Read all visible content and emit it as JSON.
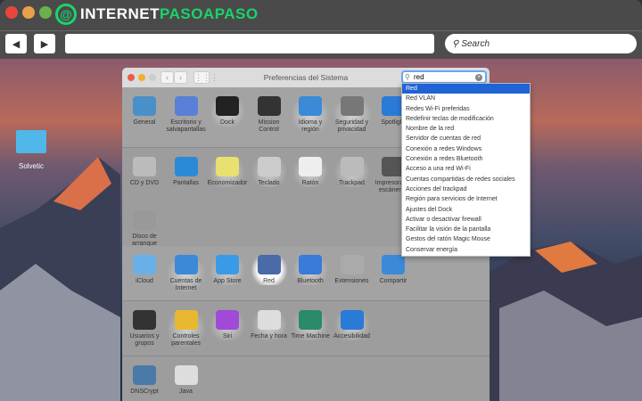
{
  "browser": {
    "logo_text_white": "INTERNET",
    "logo_text_green": "PASOAPASO",
    "back_icon": "◀",
    "forward_icon": "▶",
    "search_placeholder": "Search",
    "url_value": ""
  },
  "desktop": {
    "folder_label": "Solvetic"
  },
  "window": {
    "title": "Preferencias del Sistema",
    "nav_back": "‹",
    "nav_fwd": "›",
    "grid": "⋮⋮⋮",
    "sections": [
      [
        {
          "label": "General",
          "color": "#4a90c8"
        },
        {
          "label": "Escritorio y salvapantallas",
          "color": "#5a7fd6"
        },
        {
          "label": "Dock",
          "color": "#222"
        },
        {
          "label": "Mission Control",
          "color": "#333"
        },
        {
          "label": "Idioma y región",
          "color": "#3a8ad8"
        },
        {
          "label": "Seguridad y privacidad",
          "color": "#777"
        },
        {
          "label": "Spotlight",
          "color": "#2a7ad8"
        }
      ],
      [
        {
          "label": "CD y DVD",
          "color": "#bbb"
        },
        {
          "label": "Pantallas",
          "color": "#2a8ad8"
        },
        {
          "label": "Economizador",
          "color": "#e8e070"
        },
        {
          "label": "Teclado",
          "color": "#ccc"
        },
        {
          "label": "Ratón",
          "color": "#eee"
        },
        {
          "label": "Trackpad",
          "color": "#bbb"
        },
        {
          "label": "Impresoras y escáneres",
          "color": "#555"
        },
        {
          "label": "Disco de arranque",
          "color": "#999"
        }
      ],
      [
        {
          "label": "iCloud",
          "color": "#6ab0e8"
        },
        {
          "label": "Cuentas de Internet",
          "color": "#3a8ad8"
        },
        {
          "label": "App Store",
          "color": "#3a9ae8"
        },
        {
          "label": "Red",
          "color": "#4a6aa8"
        },
        {
          "label": "Bluetooth",
          "color": "#3a7ad8"
        },
        {
          "label": "Extensiones",
          "color": "#aaa"
        },
        {
          "label": "Compartir",
          "color": "#3a8ad8"
        }
      ],
      [
        {
          "label": "Usuarios y grupos",
          "color": "#333"
        },
        {
          "label": "Controles parentales",
          "color": "#e8b830"
        },
        {
          "label": "Siri",
          "color": "#a04ad8"
        },
        {
          "label": "Fecha y hora",
          "color": "#ddd"
        },
        {
          "label": "Time Machine",
          "color": "#2a8a6a"
        },
        {
          "label": "Accesibilidad",
          "color": "#2a7ad8"
        }
      ],
      [
        {
          "label": "DNSCrypt",
          "color": "#4a7aa8"
        },
        {
          "label": "Java",
          "color": "#ddd"
        }
      ]
    ]
  },
  "search": {
    "value": "red",
    "results": [
      "Red",
      "Red VLAN",
      "Redes Wi-Fi preferidas",
      "Redefinir teclas de modificación",
      "Nombre de la red",
      "Servidor de cuentas de red",
      "Conexión a redes Windows",
      "Conexión a redes Bluetooth",
      "Acceso a una red Wi-Fi",
      "Cuentas compartidas de redes sociales",
      "Acciones del trackpad",
      "Región para servicios de Internet",
      "Ajustes del Dock",
      "Activar o desactivar firewall",
      "Facilitar la visión de la pantalla",
      "Gestos del ratón Magic Mouse",
      "Conservar energía"
    ],
    "selected": "Red",
    "highlighted": [
      "Dock",
      "Idioma y región",
      "Seguridad y privacidad",
      "Economizador",
      "Teclado",
      "Ratón",
      "Trackpad",
      "Red",
      "Bluetooth",
      "Siri",
      "Fecha y hora",
      "Time Machine",
      "Accesibilidad",
      "Cuentas de Internet",
      "App Store",
      "Controles parentales"
    ]
  },
  "colors": {
    "accent": "#1f63d4",
    "brand_green": "#19d46a"
  }
}
